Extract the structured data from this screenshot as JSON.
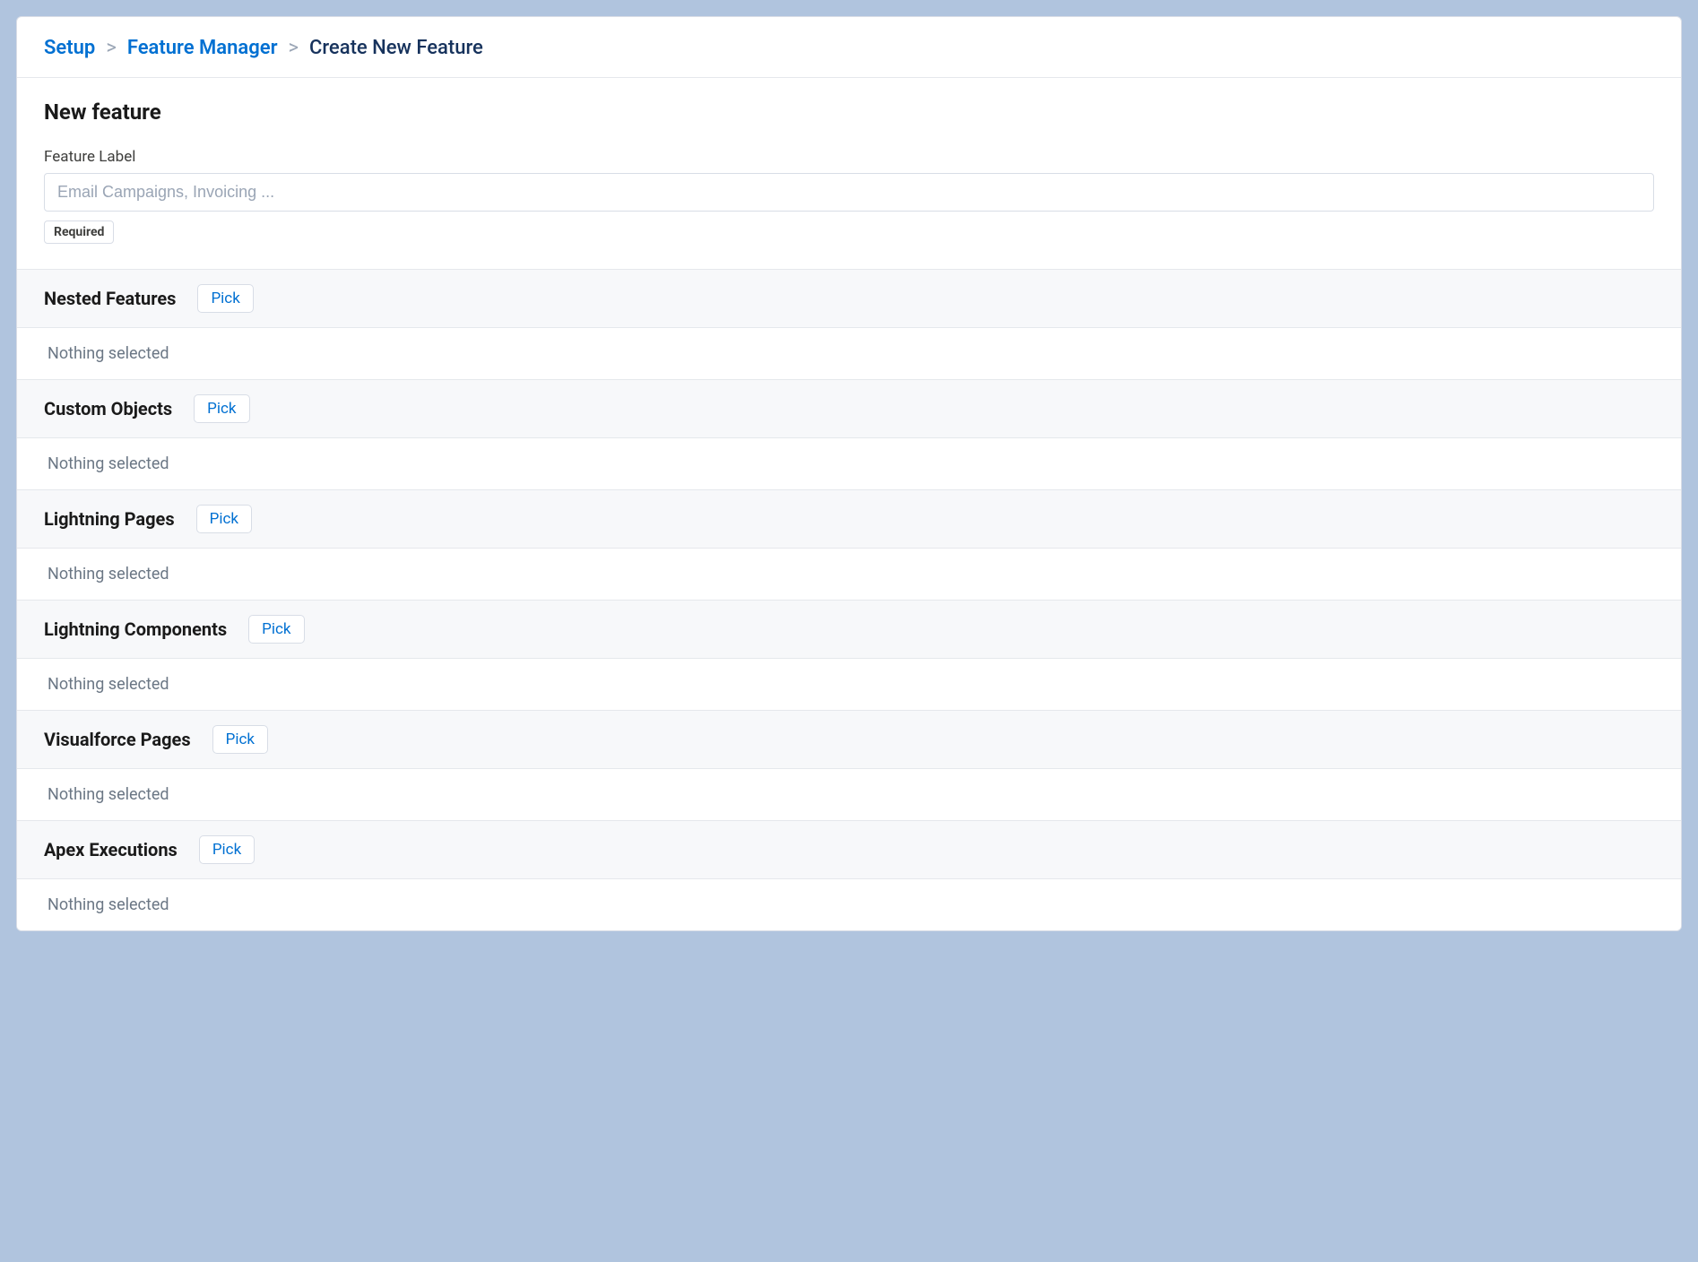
{
  "breadcrumb": {
    "setup": "Setup",
    "feature_manager": "Feature Manager",
    "current": "Create New Feature"
  },
  "page_title": "New feature",
  "feature_label": {
    "label": "Feature Label",
    "placeholder": "Email Campaigns, Invoicing ...",
    "value": "",
    "required_text": "Required"
  },
  "pick_label": "Pick",
  "nothing_selected": "Nothing selected",
  "sections": {
    "nested_features": {
      "title": "Nested Features"
    },
    "custom_objects": {
      "title": "Custom Objects"
    },
    "lightning_pages": {
      "title": "Lightning Pages"
    },
    "lightning_components": {
      "title": "Lightning Components"
    },
    "visualforce_pages": {
      "title": "Visualforce Pages"
    },
    "apex_executions": {
      "title": "Apex Executions"
    }
  }
}
